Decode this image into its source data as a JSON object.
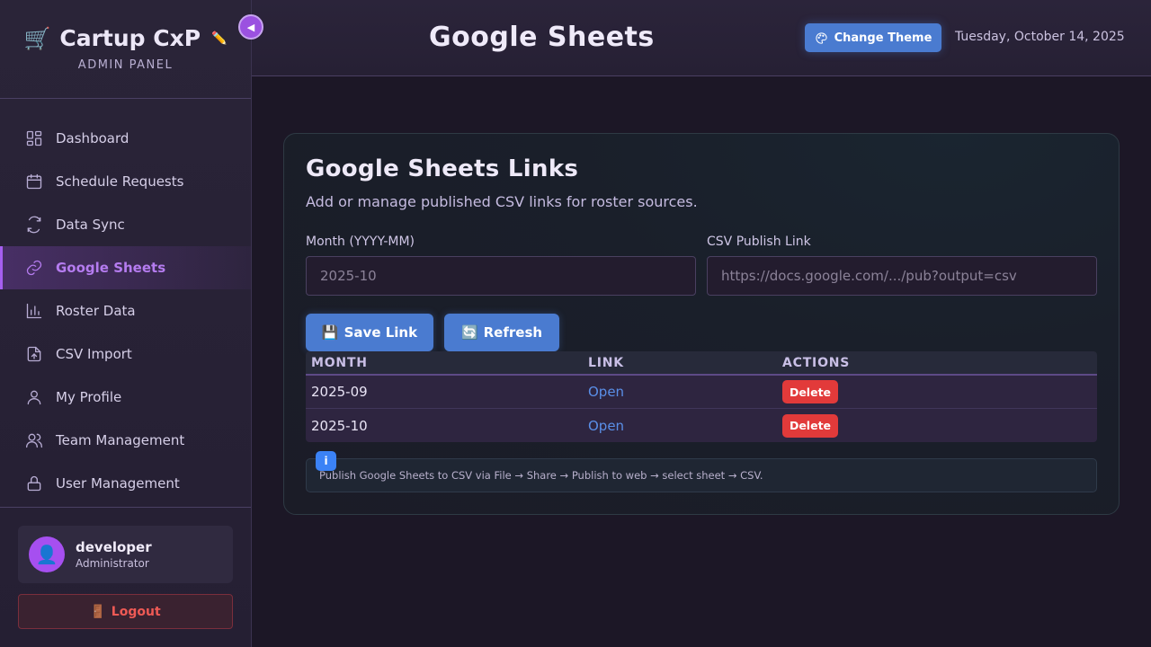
{
  "sidebar": {
    "brand_title": "Cartup CxP",
    "brand_subtitle": "ADMIN PANEL",
    "collapse_glyph": "◀",
    "items": [
      {
        "label": "Dashboard",
        "icon": "dashboard-icon",
        "active": false
      },
      {
        "label": "Schedule Requests",
        "icon": "calendar-icon",
        "active": false
      },
      {
        "label": "Data Sync",
        "icon": "sync-icon",
        "active": false
      },
      {
        "label": "Google Sheets",
        "icon": "link-icon",
        "active": true
      },
      {
        "label": "Roster Data",
        "icon": "bar-chart-icon",
        "active": false
      },
      {
        "label": "CSV Import",
        "icon": "file-upload-icon",
        "active": false
      },
      {
        "label": "My Profile",
        "icon": "user-icon",
        "active": false
      },
      {
        "label": "Team Management",
        "icon": "users-icon",
        "active": false
      },
      {
        "label": "User Management",
        "icon": "lock-icon",
        "active": false
      }
    ],
    "user": {
      "name": "developer",
      "role": "Administrator"
    },
    "logout_label": "Logout"
  },
  "header": {
    "title": "Google Sheets",
    "theme_button": "Change Theme",
    "date": "Tuesday, October 14, 2025"
  },
  "main": {
    "card_title": "Google Sheets Links",
    "card_description": "Add or manage published CSV links for roster sources.",
    "month_label": "Month (YYYY-MM)",
    "month_placeholder": "2025-10",
    "link_label": "CSV Publish Link",
    "link_placeholder": "https://docs.google.com/.../pub?output=csv",
    "save_button": "Save Link",
    "refresh_button": "Refresh",
    "table": {
      "headers": [
        "MONTH",
        "LINK",
        "ACTIONS"
      ],
      "rows": [
        {
          "month": "2025-09",
          "link": "Open",
          "action": "Delete"
        },
        {
          "month": "2025-10",
          "link": "Open",
          "action": "Delete"
        }
      ]
    },
    "info_badge": "i",
    "info_text": "Publish Google Sheets to CSV via File → Share → Publish to web → select sheet → CSV."
  },
  "colors": {
    "accent_purple": "#9b51e0",
    "primary_blue": "#4a7bd0",
    "danger_red": "#e23a3a",
    "background": "#1c1726"
  }
}
